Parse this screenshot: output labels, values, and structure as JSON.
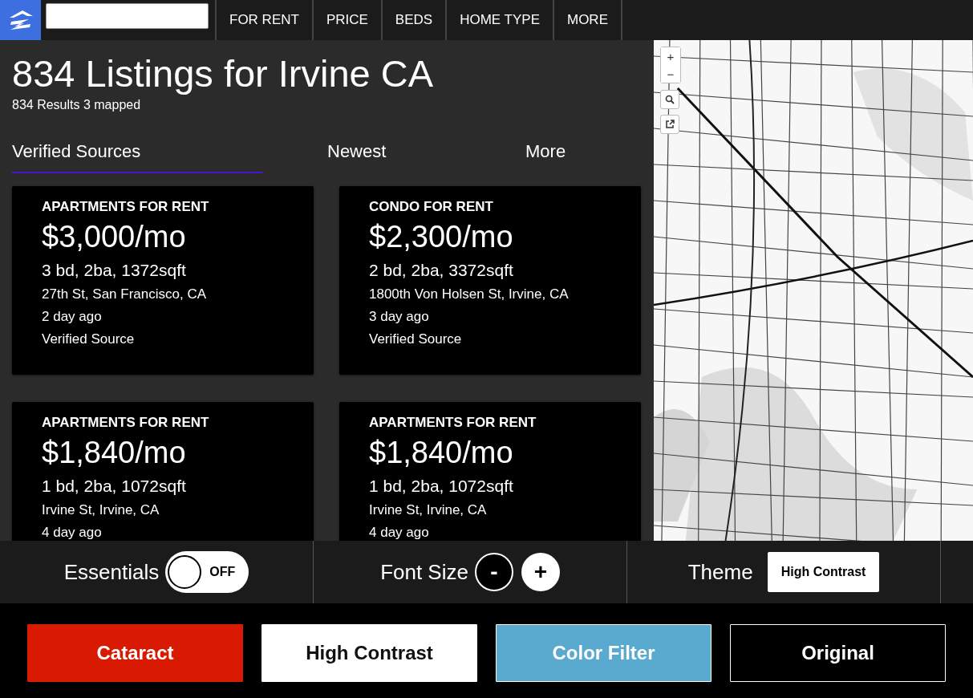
{
  "nav": {
    "menu": [
      {
        "label": "FOR RENT"
      },
      {
        "label": "PRICE"
      },
      {
        "label": "BEDS"
      },
      {
        "label": "HOME TYPE"
      },
      {
        "label": "MORE"
      }
    ]
  },
  "heading": {
    "title": "834 Listings for Irvine CA",
    "subtitle": "834 Results 3 mapped"
  },
  "tabs": [
    {
      "label": "Verified Sources",
      "selected": true
    },
    {
      "label": "Newest",
      "selected": false
    },
    {
      "label": "More",
      "selected": false
    }
  ],
  "listings": [
    {
      "type": "APARTMENTS FOR RENT",
      "price": "$3,000/mo",
      "details": "3 bd, 2ba, 1372sqft",
      "address": "27th St, San Francisco, CA",
      "age": "2 day ago",
      "source": "Verified Source"
    },
    {
      "type": "CONDO FOR RENT",
      "price": "$2,300/mo",
      "details": "2 bd, 2ba, 3372sqft",
      "address": "1800th Von Holsen St, Irvine, CA",
      "age": "3 day ago",
      "source": "Verified Source"
    },
    {
      "type": "APARTMENTS FOR RENT",
      "price": "$1,840/mo",
      "details": "1 bd, 2ba, 1072sqft",
      "address": "Irvine St, Irvine, CA",
      "age": "4 day ago"
    },
    {
      "type": "APARTMENTS FOR RENT",
      "price": "$1,840/mo",
      "details": "1 bd, 2ba, 1072sqft",
      "address": "Irvine St, Irvine, CA",
      "age": "4 day ago"
    }
  ],
  "map": {
    "zoom_in": "+",
    "zoom_out": "−"
  },
  "toolbar": {
    "essentials": {
      "label": "Essentials",
      "on": false,
      "state_text": "OFF"
    },
    "font_size": {
      "label": "Font Size",
      "decrease": "-",
      "increase": "+"
    },
    "theme": {
      "label": "Theme",
      "value": "High Contrast"
    }
  },
  "filters": [
    {
      "label": "Cataract",
      "color": "#d91a02"
    },
    {
      "label": "High Contrast",
      "color": "#ffffff"
    },
    {
      "label": "Color Filter",
      "color": "#5aa9cf"
    },
    {
      "label": "Original",
      "color": "#000000"
    }
  ]
}
